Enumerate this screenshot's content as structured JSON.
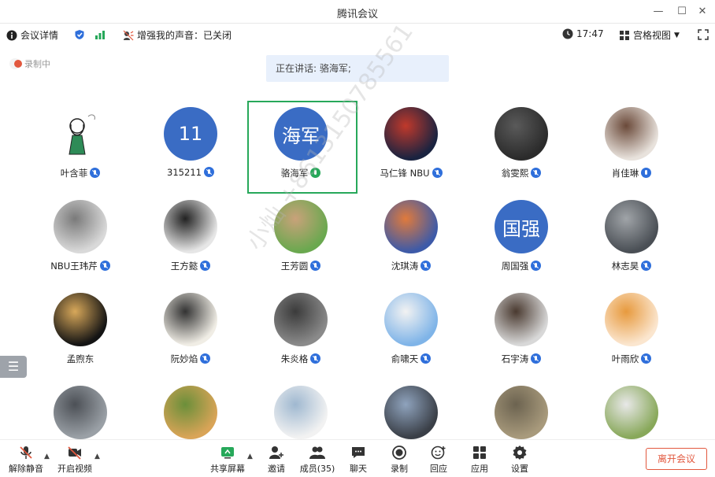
{
  "window": {
    "title": "腾讯会议"
  },
  "infobar": {
    "meeting_details": "会议详情",
    "enhance_voice": "增强我的声音：已关闭",
    "time": "17:47",
    "view_mode": "宫格视图"
  },
  "recording_label": "录制中",
  "speaking": "正在讲话: 骆海军;",
  "watermark": "小灿 +8613150785561",
  "participants": [
    {
      "name": "叶含菲",
      "avatar": "cartoon-girl",
      "mic": "muted"
    },
    {
      "name": "315211",
      "avatar_text": "11",
      "mic": "muted"
    },
    {
      "name": "骆海军",
      "avatar_text": "海军",
      "mic": "speaking",
      "highlighted": true
    },
    {
      "name": "马仁锋 NBU",
      "avatar": "city-night",
      "mic": "muted"
    },
    {
      "name": "翁雯熙",
      "avatar": "dark-photo",
      "mic": "muted"
    },
    {
      "name": "肖佳琳",
      "avatar": "girl-with-cat",
      "mic": "on"
    },
    {
      "name": "NBU王玮芹",
      "avatar": "white-cat",
      "mic": "muted"
    },
    {
      "name": "王方懿",
      "avatar": "anime-bw",
      "mic": "muted"
    },
    {
      "name": "王芳圆",
      "avatar": "girl-green",
      "mic": "muted"
    },
    {
      "name": "沈琪涛",
      "avatar": "anime-boy",
      "mic": "muted"
    },
    {
      "name": "周国强",
      "avatar_text": "国强",
      "mic": "muted"
    },
    {
      "name": "林志昊",
      "avatar": "game-character",
      "mic": "muted"
    },
    {
      "name": "孟煦东",
      "avatar": "night-light",
      "mic": "none"
    },
    {
      "name": "阮妙焰",
      "avatar": "fan-art",
      "mic": "muted"
    },
    {
      "name": "朱炎格",
      "avatar": "man-portrait",
      "mic": "muted"
    },
    {
      "name": "俞啸天",
      "avatar": "anime-sky",
      "mic": "muted"
    },
    {
      "name": "石宇涛",
      "avatar": "young-man",
      "mic": "muted"
    },
    {
      "name": "叶雨欣",
      "avatar": "cartoon-orange",
      "mic": "muted"
    },
    {
      "name": "",
      "avatar": "street",
      "mic": "none"
    },
    {
      "name": "",
      "avatar": "dog",
      "mic": "none"
    },
    {
      "name": "",
      "avatar": "sketch",
      "mic": "none"
    },
    {
      "name": "",
      "avatar": "piano",
      "mic": "none"
    },
    {
      "name": "",
      "avatar": "tank",
      "mic": "none"
    },
    {
      "name": "",
      "avatar": "house",
      "mic": "none"
    }
  ],
  "toolbar": {
    "unmute": "解除静音",
    "start_video": "开启视频",
    "share_screen": "共享屏幕",
    "invite": "邀请",
    "members": "成员(35)",
    "chat": "聊天",
    "record": "录制",
    "reply": "回应",
    "apps": "应用",
    "settings": "设置",
    "leave": "离开会议"
  },
  "colors": {
    "accent": "#2f6fdb",
    "highlight": "#27a85a",
    "leave": "#e2583e"
  }
}
